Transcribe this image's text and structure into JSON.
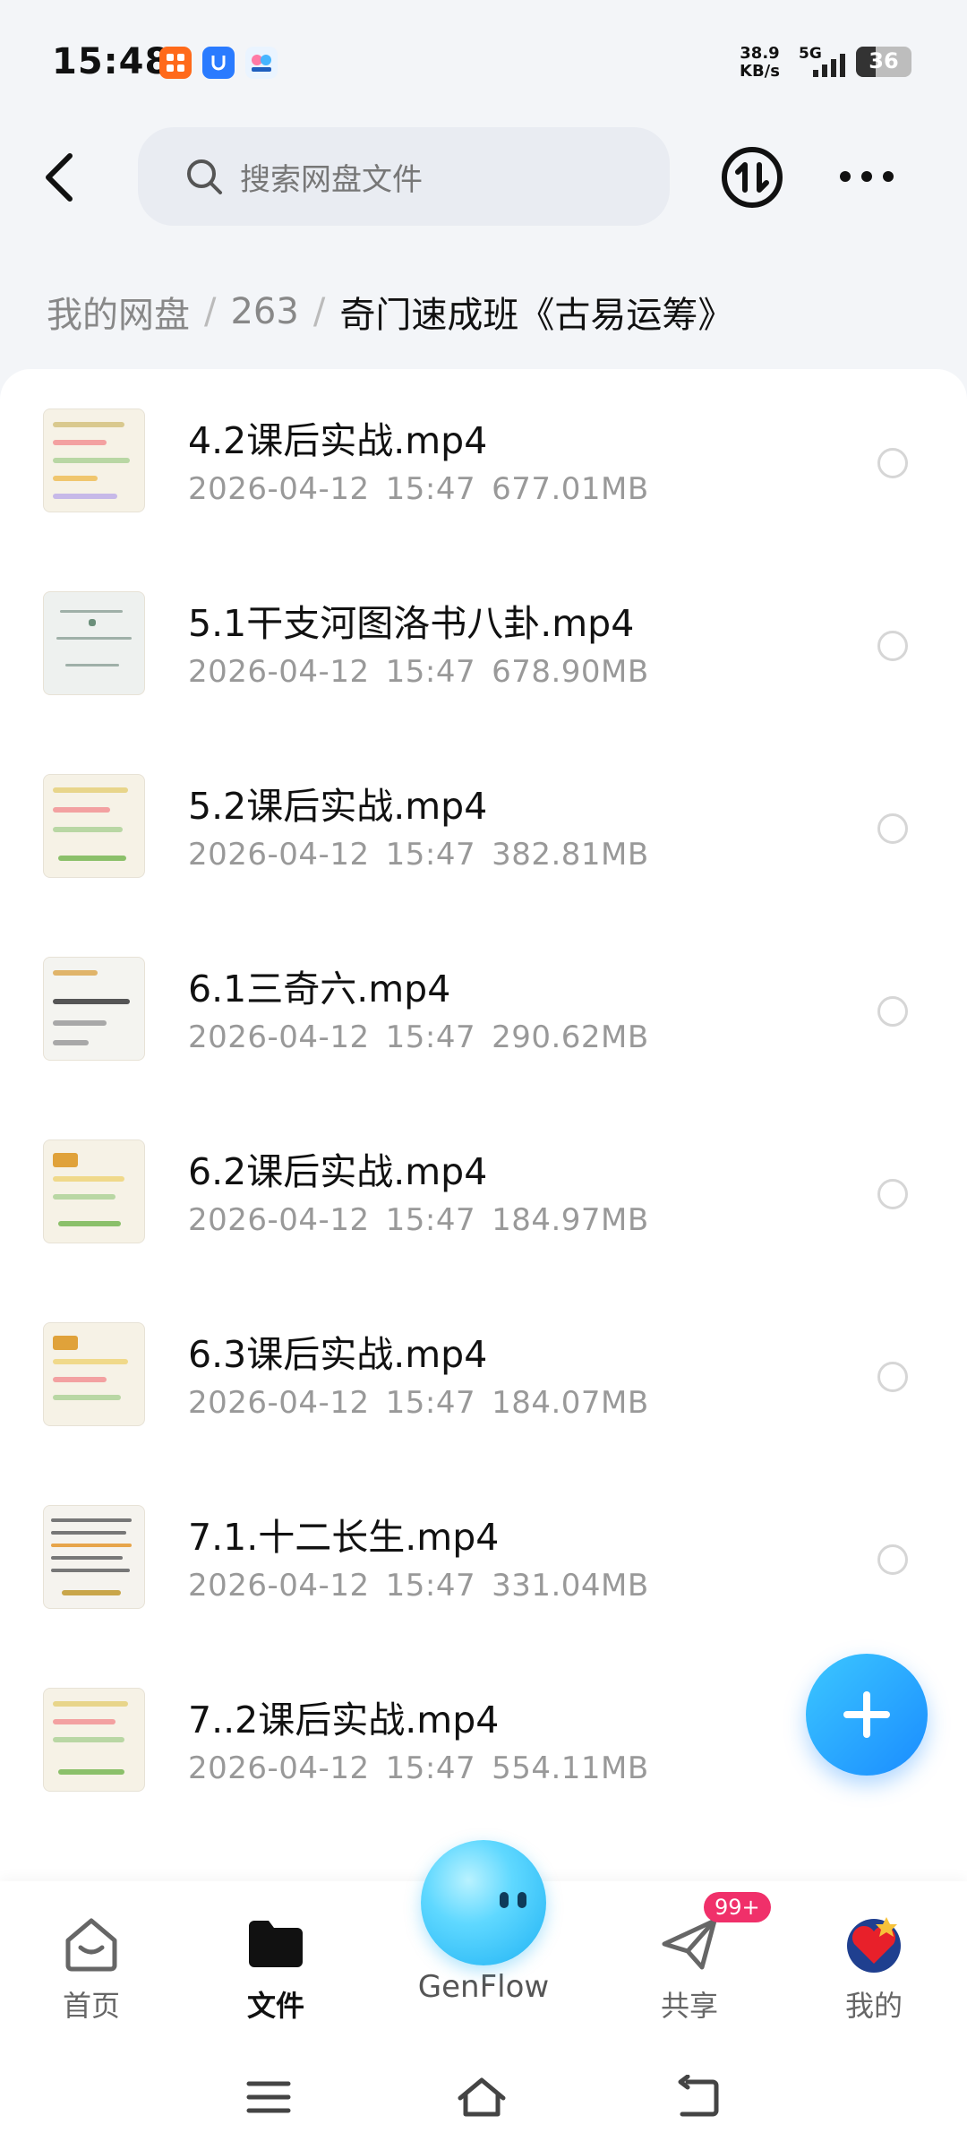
{
  "status_bar": {
    "time": "15:48",
    "net_speed_value": "38.9",
    "net_speed_unit": "KB/s",
    "network_type": "5G",
    "battery": "36",
    "icons": [
      "taobao-icon",
      "shield-app-icon",
      "genflow-app-icon"
    ]
  },
  "header": {
    "search_placeholder": "搜索网盘文件",
    "icons": [
      "back-arrow-icon",
      "search-icon",
      "sort-icon",
      "more-icon"
    ]
  },
  "breadcrumb": {
    "items": [
      "我的网盘",
      "263"
    ],
    "separator": "/",
    "current": "奇门速成班《古易运筹》"
  },
  "files": [
    {
      "name": "4.2课后实战.mp4",
      "date": "2026-04-12",
      "time": "15:47",
      "size": "677.01MB"
    },
    {
      "name": "5.1干支河图洛书八卦.mp4",
      "date": "2026-04-12",
      "time": "15:47",
      "size": "678.90MB"
    },
    {
      "name": "5.2课后实战.mp4",
      "date": "2026-04-12",
      "time": "15:47",
      "size": "382.81MB"
    },
    {
      "name": "6.1三奇六.mp4",
      "date": "2026-04-12",
      "time": "15:47",
      "size": "290.62MB"
    },
    {
      "name": "6.2课后实战.mp4",
      "date": "2026-04-12",
      "time": "15:47",
      "size": "184.97MB"
    },
    {
      "name": "6.3课后实战.mp4",
      "date": "2026-04-12",
      "time": "15:47",
      "size": "184.07MB"
    },
    {
      "name": "7.1.十二长生.mp4",
      "date": "2026-04-12",
      "time": "15:47",
      "size": "331.04MB"
    },
    {
      "name": "7..2课后实战.mp4",
      "date": "2026-04-12",
      "time": "15:47",
      "size": "554.11MB"
    }
  ],
  "bottom_nav": {
    "home": "首页",
    "files": "文件",
    "genflow": "GenFlow",
    "share": "共享",
    "share_badge": "99+",
    "mine": "我的"
  },
  "colors": {
    "accent": "#1a8cff",
    "badge": "#f0306a",
    "background": "#f3f5f8"
  }
}
